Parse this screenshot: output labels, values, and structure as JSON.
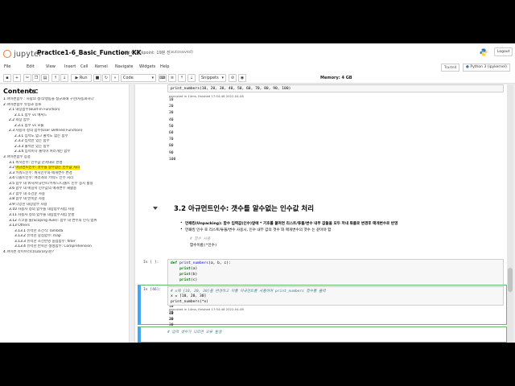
{
  "header": {
    "logo_text": "jupyter",
    "notebook_name": "Practice1-6_Basic_Function_KK",
    "checkpoint": "Last Checkpoint: 19분 전",
    "autosave": "(autosaved)",
    "logout": "Logout"
  },
  "menubar": {
    "items": [
      "File",
      "Edit",
      "View",
      "Insert",
      "Cell",
      "Kernel",
      "Navigate",
      "Widgets",
      "Help"
    ],
    "trusted": "Trusted",
    "kernel": "Python 3 (ipykernel)"
  },
  "toolbar": {
    "run": "Run",
    "cell_type": "Code",
    "snippets": "Snippets",
    "memory": "Memory: 4 GB"
  },
  "toc": {
    "title": "Contents",
    "items": [
      {
        "n": "1",
        "text": "파이썬함수 : 사람의 생각/행동을 정규화해 구현/자동화하다",
        "lvl": 1
      },
      {
        "n": "2",
        "text": "파이썬함수 유형과 종류",
        "lvl": 1
      },
      {
        "n": "2.1",
        "text": "내장함수(Built-in Function)",
        "lvl": 2
      },
      {
        "n": "2.1.1",
        "text": "함수 vs 메서드",
        "lvl": 3
      },
      {
        "n": "2.2",
        "text": "외장 함수",
        "lvl": 2
      },
      {
        "n": "2.2.1",
        "text": "함수 vs 모듈",
        "lvl": 3
      },
      {
        "n": "2.3",
        "text": "사용자 정의 함수(User Defined Function)",
        "lvl": 2
      },
      {
        "n": "2.3.1",
        "text": "입력도 없고 출력도 없는 함수",
        "lvl": 3
      },
      {
        "n": "2.3.2",
        "text": "입력만 있는 함수",
        "lvl": 3
      },
      {
        "n": "2.3.3",
        "text": "출력만 있는 함수",
        "lvl": 3
      },
      {
        "n": "2.3.4",
        "text": "입력이나 출력이 여러개인 함수",
        "lvl": 3
      },
      {
        "n": "3",
        "text": "파이썬함수 응용",
        "lvl": 1
      },
      {
        "n": "3.1",
        "text": "위치인수: 인수값 순서대로 반영",
        "lvl": 2
      },
      {
        "n": "3.2",
        "text": "아규먼트인수: 갯수를 알수없는 인수값 처리",
        "lvl": 2,
        "hl": true
      },
      {
        "n": "3.3",
        "text": "키워드인수: 위치인수와 매개변수 변경",
        "lvl": 2
      },
      {
        "n": "3.4",
        "text": "디폴트인수: 여러개의 키워드 인수 처리",
        "lvl": 2
      },
      {
        "n": "3.5",
        "text": "함수 내 위치/아규먼트/키워드/디폴트 인수 동시 활용",
        "lvl": 2
      },
      {
        "n": "3.6",
        "text": "함수 내 매길학 인수값의 매개변수 재활용",
        "lvl": 2
      },
      {
        "n": "3.7",
        "text": "함수 내 조건문 사용",
        "lvl": 2
      },
      {
        "n": "3.8",
        "text": "함수 내 반복문 사용",
        "lvl": 2
      },
      {
        "n": "3.9",
        "text": "다양한 내장함수 사용",
        "lvl": 2
      },
      {
        "n": "3.10",
        "text": "사용자 정의 함수를 내장함수처럼 사용",
        "lvl": 2
      },
      {
        "n": "3.11",
        "text": "사용자 정의 함수를 내장함수처럼 분할",
        "lvl": 2
      },
      {
        "n": "3.12",
        "text": "스코핑 룰(Scoping Rule): 함수 내 변수의 인식 범위",
        "lvl": 2
      },
      {
        "n": "3.13",
        "text": "Others",
        "lvl": 2
      },
      {
        "n": "3.13.1",
        "text": "유력한 조건식: lambda",
        "lvl": 3
      },
      {
        "n": "3.13.2",
        "text": "유력한 중첩함수: map",
        "lvl": 3
      },
      {
        "n": "3.13.3",
        "text": "유력한 조건반영 중첩함수: filter",
        "lvl": 3
      },
      {
        "n": "3.13.4",
        "text": "유력한 반복문 생성함수: Comprehension",
        "lvl": 3
      },
      {
        "n": "4",
        "text": "파이썬 라이브러리(Library)란?",
        "lvl": 1
      }
    ]
  },
  "notebook": {
    "top_code": "print_numbers(10, 20, 30, 40, 50, 60, 70, 80, 90, 100)",
    "top_exec": "executed in 14ms, finished 17:54:46 2022-04-08",
    "top_outputs": [
      "10",
      "20",
      "30",
      "40",
      "50",
      "60",
      "70",
      "80",
      "90",
      "100"
    ],
    "heading": "3.2  아규먼트인수: 갯수를 알수없는 인수값 처리",
    "bullet1": "언패킹(Unpacking): 함수 입력값(인수)앞에 * 기호를 붙여면 리스트/튜플/변수 내부 값들을 모두 꺼내 튜플로 변경후 매개변수로 반영",
    "bullet2": "언패킹 인수 로 리스트/튜플/변수 사용시, 인수 내부 값의 갯수 와 매개변수의 갯수 는 같아야 함",
    "format_comment": "# 함수 사용",
    "format_line": "함수이름(*인수)",
    "cell1_prompt": "In [ ]:",
    "cell1_code": [
      "def print_numbers(a, b, c):",
      "    print(a)",
      "    print(b)",
      "    print(c)",
      "",
      "# print_numbers([10, 20, 30])",
      "print_numbers(*[10, 20, 30])"
    ],
    "cell1_exec": "executed in 6ms, finished 03:28:54 2022-04-09",
    "cell1_outputs": [
      "10",
      "20",
      "30"
    ],
    "cell2_prompt": "In [46]:",
    "cell2_code": [
      "# x에 [10, 20, 30]을 변경하고 이를 아규먼트를 사용하여 print_numbers 함수를 출력",
      "x = [10, 20, 30]",
      "print_numbers(*x)"
    ],
    "cell2_exec": "executed in 14ms, finished 17:54:46 2022-04-08",
    "cell2_outputs": [
      "10",
      "20",
      "30"
    ],
    "cell3_code": "# 입력 갯수가 다르면 오류 발생"
  }
}
